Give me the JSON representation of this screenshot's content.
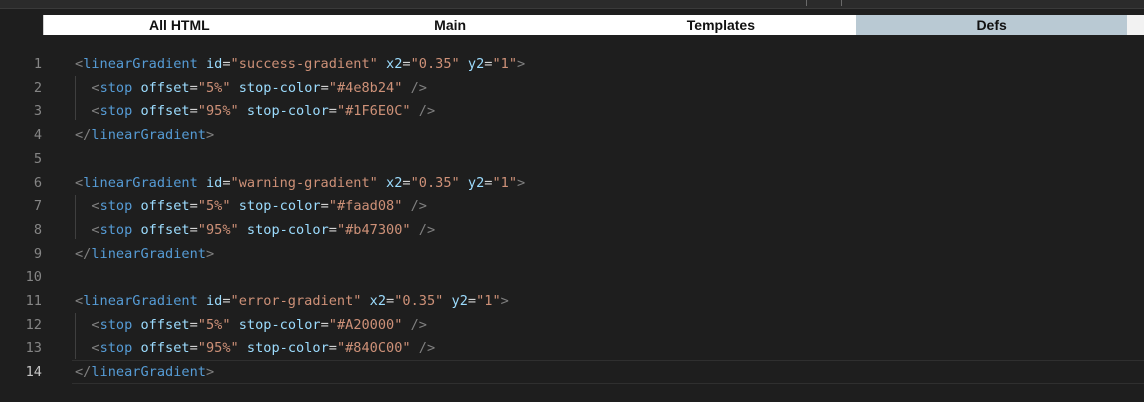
{
  "tabs": [
    {
      "label": "All HTML",
      "active": false
    },
    {
      "label": "Main",
      "active": false
    },
    {
      "label": "Templates",
      "active": false
    },
    {
      "label": "Defs",
      "active": true
    }
  ],
  "current_line": 14,
  "colors": {
    "editor_background": "#1e1e1e",
    "tag": "#569cd6",
    "attribute": "#9cdcfe",
    "string": "#ce9178",
    "punctuation": "#808080",
    "active_tab": "#b9c9d3"
  },
  "code_lines": [
    {
      "n": "1",
      "indent": "",
      "tokens": [
        {
          "t": "<",
          "c": "punc"
        },
        {
          "t": "linearGradient",
          "c": "tag"
        },
        {
          "t": " ",
          "c": "eq"
        },
        {
          "t": "id",
          "c": "attr"
        },
        {
          "t": "=",
          "c": "eq"
        },
        {
          "t": "\"success-gradient\"",
          "c": "str"
        },
        {
          "t": " ",
          "c": "eq"
        },
        {
          "t": "x2",
          "c": "attr"
        },
        {
          "t": "=",
          "c": "eq"
        },
        {
          "t": "\"0.35\"",
          "c": "str"
        },
        {
          "t": " ",
          "c": "eq"
        },
        {
          "t": "y2",
          "c": "attr"
        },
        {
          "t": "=",
          "c": "eq"
        },
        {
          "t": "\"1\"",
          "c": "str"
        },
        {
          "t": ">",
          "c": "punc"
        }
      ]
    },
    {
      "n": "2",
      "indent": "  ",
      "tokens": [
        {
          "t": "<",
          "c": "punc"
        },
        {
          "t": "stop",
          "c": "tag"
        },
        {
          "t": " ",
          "c": "eq"
        },
        {
          "t": "offset",
          "c": "attr"
        },
        {
          "t": "=",
          "c": "eq"
        },
        {
          "t": "\"5%\"",
          "c": "str"
        },
        {
          "t": " ",
          "c": "eq"
        },
        {
          "t": "stop-color",
          "c": "attr"
        },
        {
          "t": "=",
          "c": "eq"
        },
        {
          "t": "\"#4e8b24\"",
          "c": "str"
        },
        {
          "t": " ",
          "c": "eq"
        },
        {
          "t": "/>",
          "c": "punc"
        }
      ]
    },
    {
      "n": "3",
      "indent": "  ",
      "tokens": [
        {
          "t": "<",
          "c": "punc"
        },
        {
          "t": "stop",
          "c": "tag"
        },
        {
          "t": " ",
          "c": "eq"
        },
        {
          "t": "offset",
          "c": "attr"
        },
        {
          "t": "=",
          "c": "eq"
        },
        {
          "t": "\"95%\"",
          "c": "str"
        },
        {
          "t": " ",
          "c": "eq"
        },
        {
          "t": "stop-color",
          "c": "attr"
        },
        {
          "t": "=",
          "c": "eq"
        },
        {
          "t": "\"#1F6E0C\"",
          "c": "str"
        },
        {
          "t": " ",
          "c": "eq"
        },
        {
          "t": "/>",
          "c": "punc"
        }
      ]
    },
    {
      "n": "4",
      "indent": "",
      "tokens": [
        {
          "t": "</",
          "c": "punc"
        },
        {
          "t": "linearGradient",
          "c": "tag"
        },
        {
          "t": ">",
          "c": "punc"
        }
      ]
    },
    {
      "n": "5",
      "indent": "",
      "tokens": []
    },
    {
      "n": "6",
      "indent": "",
      "tokens": [
        {
          "t": "<",
          "c": "punc"
        },
        {
          "t": "linearGradient",
          "c": "tag"
        },
        {
          "t": " ",
          "c": "eq"
        },
        {
          "t": "id",
          "c": "attr"
        },
        {
          "t": "=",
          "c": "eq"
        },
        {
          "t": "\"warning-gradient\"",
          "c": "str"
        },
        {
          "t": " ",
          "c": "eq"
        },
        {
          "t": "x2",
          "c": "attr"
        },
        {
          "t": "=",
          "c": "eq"
        },
        {
          "t": "\"0.35\"",
          "c": "str"
        },
        {
          "t": " ",
          "c": "eq"
        },
        {
          "t": "y2",
          "c": "attr"
        },
        {
          "t": "=",
          "c": "eq"
        },
        {
          "t": "\"1\"",
          "c": "str"
        },
        {
          "t": ">",
          "c": "punc"
        }
      ]
    },
    {
      "n": "7",
      "indent": "  ",
      "tokens": [
        {
          "t": "<",
          "c": "punc"
        },
        {
          "t": "stop",
          "c": "tag"
        },
        {
          "t": " ",
          "c": "eq"
        },
        {
          "t": "offset",
          "c": "attr"
        },
        {
          "t": "=",
          "c": "eq"
        },
        {
          "t": "\"5%\"",
          "c": "str"
        },
        {
          "t": " ",
          "c": "eq"
        },
        {
          "t": "stop-color",
          "c": "attr"
        },
        {
          "t": "=",
          "c": "eq"
        },
        {
          "t": "\"#faad08\"",
          "c": "str"
        },
        {
          "t": " ",
          "c": "eq"
        },
        {
          "t": "/>",
          "c": "punc"
        }
      ]
    },
    {
      "n": "8",
      "indent": "  ",
      "tokens": [
        {
          "t": "<",
          "c": "punc"
        },
        {
          "t": "stop",
          "c": "tag"
        },
        {
          "t": " ",
          "c": "eq"
        },
        {
          "t": "offset",
          "c": "attr"
        },
        {
          "t": "=",
          "c": "eq"
        },
        {
          "t": "\"95%\"",
          "c": "str"
        },
        {
          "t": " ",
          "c": "eq"
        },
        {
          "t": "stop-color",
          "c": "attr"
        },
        {
          "t": "=",
          "c": "eq"
        },
        {
          "t": "\"#b47300\"",
          "c": "str"
        },
        {
          "t": " ",
          "c": "eq"
        },
        {
          "t": "/>",
          "c": "punc"
        }
      ]
    },
    {
      "n": "9",
      "indent": "",
      "tokens": [
        {
          "t": "</",
          "c": "punc"
        },
        {
          "t": "linearGradient",
          "c": "tag"
        },
        {
          "t": ">",
          "c": "punc"
        }
      ]
    },
    {
      "n": "10",
      "indent": "",
      "tokens": []
    },
    {
      "n": "11",
      "indent": "",
      "tokens": [
        {
          "t": "<",
          "c": "punc"
        },
        {
          "t": "linearGradient",
          "c": "tag"
        },
        {
          "t": " ",
          "c": "eq"
        },
        {
          "t": "id",
          "c": "attr"
        },
        {
          "t": "=",
          "c": "eq"
        },
        {
          "t": "\"error-gradient\"",
          "c": "str"
        },
        {
          "t": " ",
          "c": "eq"
        },
        {
          "t": "x2",
          "c": "attr"
        },
        {
          "t": "=",
          "c": "eq"
        },
        {
          "t": "\"0.35\"",
          "c": "str"
        },
        {
          "t": " ",
          "c": "eq"
        },
        {
          "t": "y2",
          "c": "attr"
        },
        {
          "t": "=",
          "c": "eq"
        },
        {
          "t": "\"1\"",
          "c": "str"
        },
        {
          "t": ">",
          "c": "punc"
        }
      ]
    },
    {
      "n": "12",
      "indent": "  ",
      "tokens": [
        {
          "t": "<",
          "c": "punc"
        },
        {
          "t": "stop",
          "c": "tag"
        },
        {
          "t": " ",
          "c": "eq"
        },
        {
          "t": "offset",
          "c": "attr"
        },
        {
          "t": "=",
          "c": "eq"
        },
        {
          "t": "\"5%\"",
          "c": "str"
        },
        {
          "t": " ",
          "c": "eq"
        },
        {
          "t": "stop-color",
          "c": "attr"
        },
        {
          "t": "=",
          "c": "eq"
        },
        {
          "t": "\"#A20000\"",
          "c": "str"
        },
        {
          "t": " ",
          "c": "eq"
        },
        {
          "t": "/>",
          "c": "punc"
        }
      ]
    },
    {
      "n": "13",
      "indent": "  ",
      "tokens": [
        {
          "t": "<",
          "c": "punc"
        },
        {
          "t": "stop",
          "c": "tag"
        },
        {
          "t": " ",
          "c": "eq"
        },
        {
          "t": "offset",
          "c": "attr"
        },
        {
          "t": "=",
          "c": "eq"
        },
        {
          "t": "\"95%\"",
          "c": "str"
        },
        {
          "t": " ",
          "c": "eq"
        },
        {
          "t": "stop-color",
          "c": "attr"
        },
        {
          "t": "=",
          "c": "eq"
        },
        {
          "t": "\"#840C00\"",
          "c": "str"
        },
        {
          "t": " ",
          "c": "eq"
        },
        {
          "t": "/>",
          "c": "punc"
        }
      ]
    },
    {
      "n": "14",
      "indent": "",
      "tokens": [
        {
          "t": "</",
          "c": "punc"
        },
        {
          "t": "linearGradient",
          "c": "tag"
        },
        {
          "t": ">",
          "c": "punc"
        }
      ]
    }
  ]
}
